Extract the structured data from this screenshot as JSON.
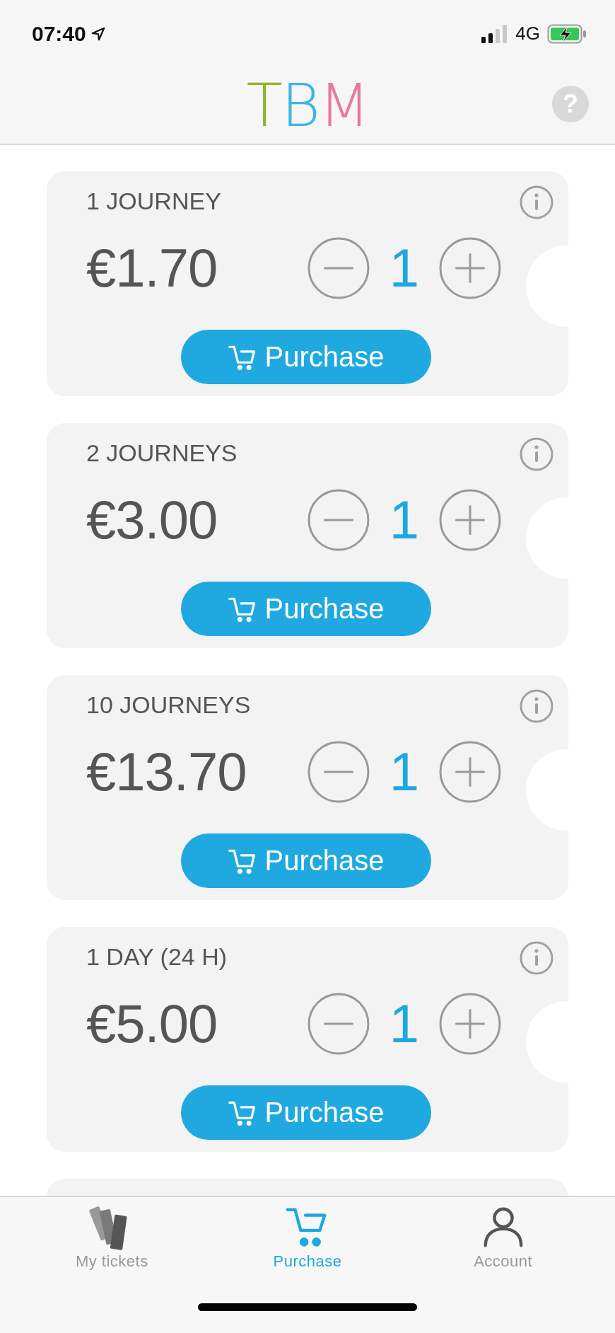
{
  "status_bar": {
    "time": "07:40",
    "network": "4G"
  },
  "header": {
    "logo": "TBM",
    "help": "?"
  },
  "tickets": [
    {
      "title": "1 JOURNEY",
      "price": "€1.70",
      "quantity": "1",
      "button": "Purchase"
    },
    {
      "title": "2 JOURNEYS",
      "price": "€3.00",
      "quantity": "1",
      "button": "Purchase"
    },
    {
      "title": "10 JOURNEYS",
      "price": "€13.70",
      "quantity": "1",
      "button": "Purchase"
    },
    {
      "title": "1 DAY (24 H)",
      "price": "€5.00",
      "quantity": "1",
      "button": "Purchase"
    }
  ],
  "tab_bar": [
    {
      "label": "My tickets",
      "kind": "tickets",
      "selected": false
    },
    {
      "label": "Purchase",
      "kind": "cart",
      "selected": true
    },
    {
      "label": "Account",
      "kind": "account",
      "selected": false
    }
  ]
}
